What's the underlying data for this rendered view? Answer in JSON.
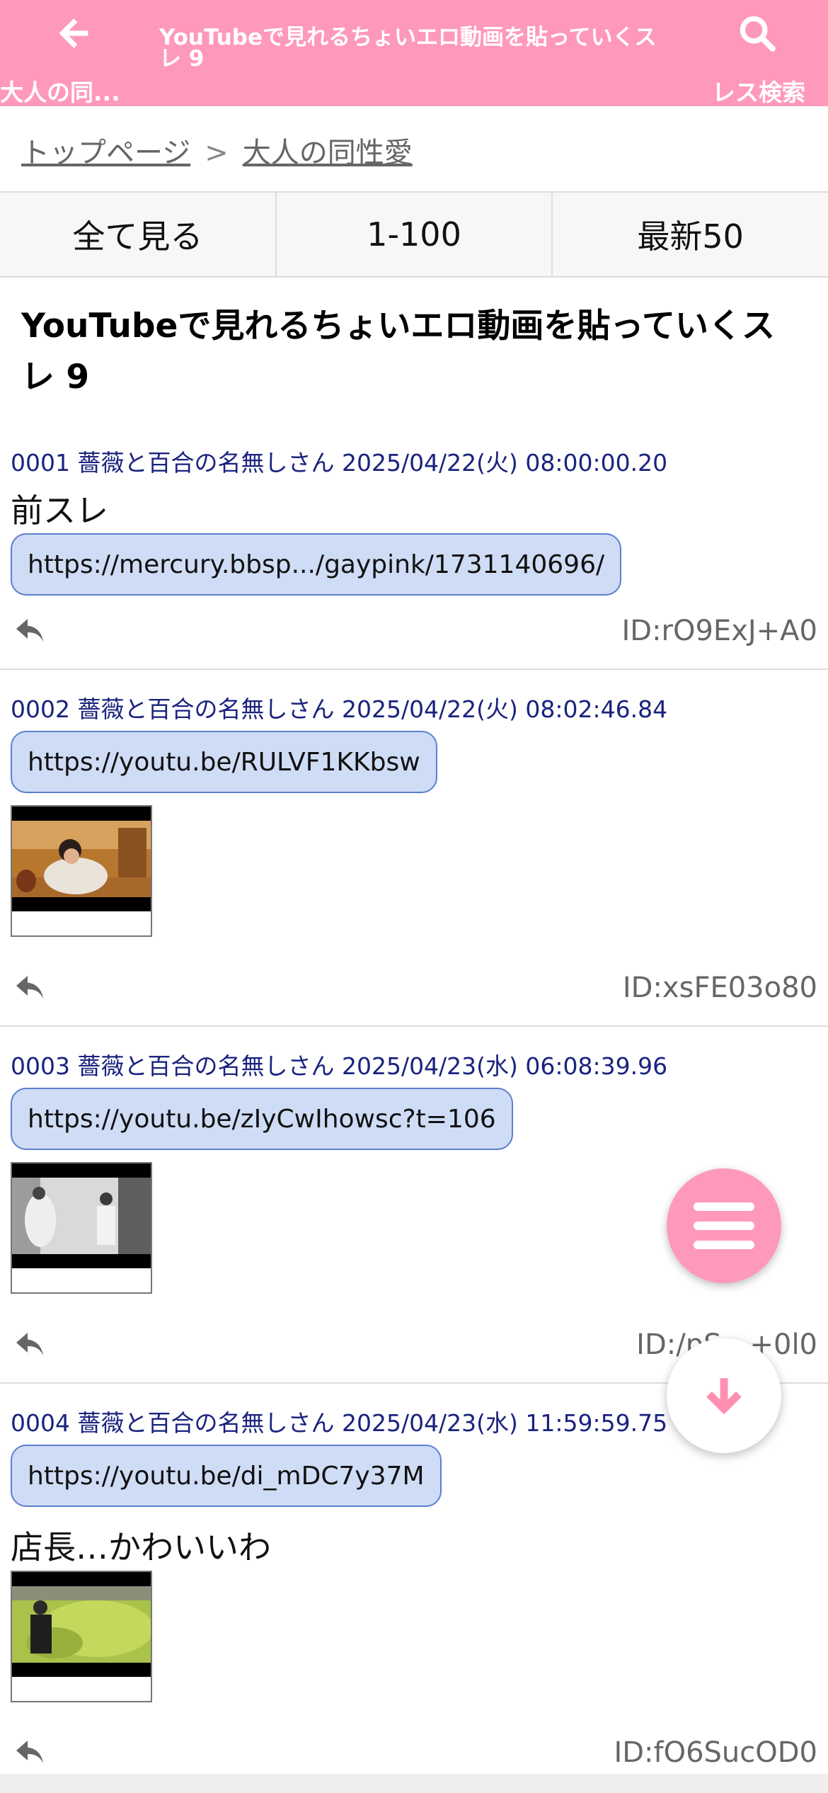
{
  "header": {
    "back_label": "大人の同...",
    "title": "YouTubeで見れるちょいエロ動画を貼っていくスレ 9",
    "search_label": "レス検索"
  },
  "breadcrumb": {
    "home": "トップページ",
    "separator": ">",
    "board": "大人の同性愛"
  },
  "tabs": [
    "全て見る",
    "1-100",
    "最新50"
  ],
  "thread_title": "YouTubeで見れるちょいエロ動画を貼っていくスレ 9",
  "posts": [
    {
      "meta": "0001 薔薇と百合の名無しさん 2025/04/22(火) 08:00:00.20",
      "text_before": "前スレ",
      "link": "https://mercury.bbsp.../gaypink/1731140696/",
      "text_after": "",
      "id": "ID:rO9ExJ+A0"
    },
    {
      "meta": "0002 薔薇と百合の名無しさん 2025/04/22(火) 08:02:46.84",
      "text_before": "",
      "link": "https://youtu.be/RULVF1KKbsw",
      "text_after": "",
      "id": "ID:xsFE03o80"
    },
    {
      "meta": "0003 薔薇と百合の名無しさん 2025/04/23(水) 06:08:39.96",
      "text_before": "",
      "link": "https://youtu.be/zIyCwIhowsc?t=106",
      "text_after": "",
      "id": "ID:/pS…+0l0"
    },
    {
      "meta": "0004 薔薇と百合の名無しさん 2025/04/23(水) 11:59:59.75",
      "text_before": "",
      "link": "https://youtu.be/di_mDC7y37M",
      "text_after": "店長…かわいいわ",
      "id": "ID:fO6SucOD0"
    }
  ],
  "colors": {
    "header": "#ff99bb",
    "link_bg": "#cfdcf5",
    "link_border": "#5b7fd0",
    "meta_text": "#1a237e"
  },
  "icons": [
    "back-arrow-icon",
    "search-icon",
    "reply-icon",
    "menu-icon",
    "arrow-down-icon"
  ]
}
